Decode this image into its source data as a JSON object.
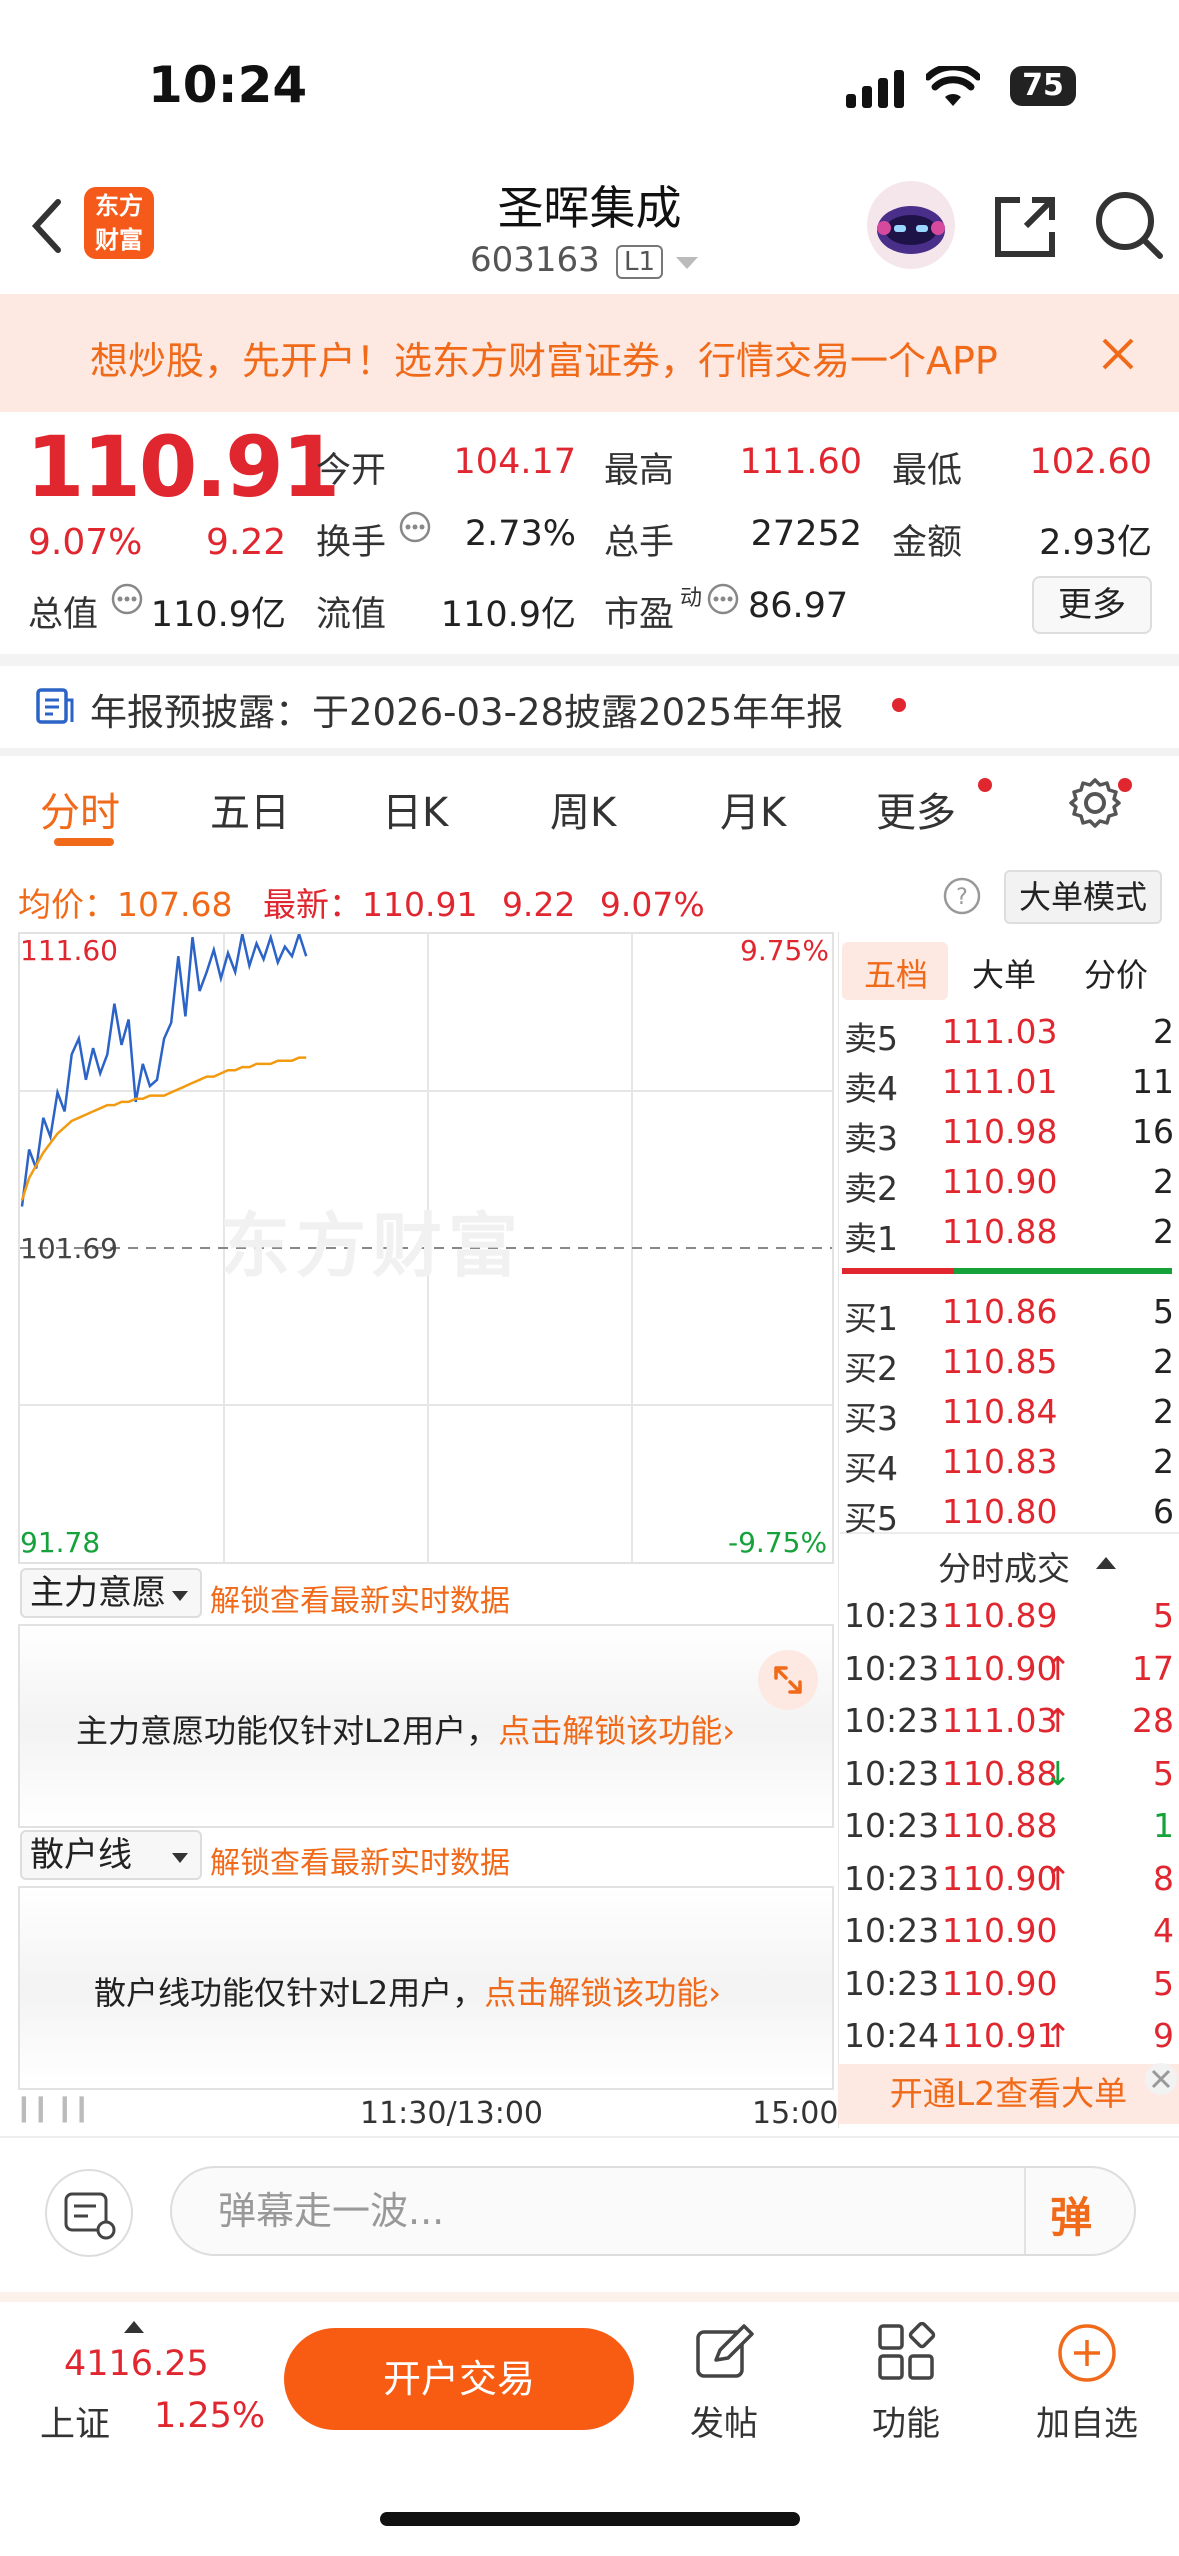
{
  "status": {
    "time": "10:24",
    "battery": "75"
  },
  "header": {
    "logo": [
      "东方",
      "财富"
    ],
    "title": "圣晖集成",
    "code": "603163",
    "level": "L1"
  },
  "banner": {
    "text": "想炒股，先开户！选东方财富证券，行情交易一个APP"
  },
  "quote": {
    "price": "110.91",
    "pct": "9.07%",
    "change": "9.22",
    "open_label": "今开",
    "open": "104.17",
    "high_label": "最高",
    "high": "111.60",
    "low_label": "最低",
    "low": "102.60",
    "turnover_label": "换手",
    "turnover": "2.73%",
    "volume_label": "总手",
    "volume": "27252",
    "amount_label": "金额",
    "amount": "2.93亿",
    "mktcap_label": "总值",
    "mktcap": "110.9亿",
    "float_label": "流值",
    "float": "110.9亿",
    "pe_label": "市盈",
    "pe_sup": "动",
    "pe": "86.97",
    "more": "更多"
  },
  "notice": {
    "text": "年报预披露：于2026-03-28披露2025年年报"
  },
  "tabs": [
    "分时",
    "五日",
    "日K",
    "周K",
    "月K",
    "更多"
  ],
  "info": {
    "avg_label": "均价：",
    "avg": "107.68",
    "last_label": "最新：",
    "last": "110.91",
    "chg": "9.22",
    "pct": "9.07%",
    "big_order": "大单模式"
  },
  "chart_data": {
    "type": "line",
    "title": "",
    "ylim": [
      91.78,
      111.6
    ],
    "y_top_label": "111.60",
    "y_mid_label": "101.69",
    "y_bottom_label": "91.78",
    "pct_top_label": "9.75%",
    "pct_bottom_label": "-9.75%",
    "x_labels": [
      "",
      "11:30/13:00",
      "15:00"
    ],
    "series": [
      {
        "color": "#2b63c6",
        "values": [
          103.0,
          104.8,
          104.2,
          105.8,
          105.2,
          106.6,
          106.0,
          107.8,
          108.3,
          107.0,
          108.0,
          107.2,
          107.8,
          109.4,
          108.1,
          108.9,
          106.3,
          107.5,
          106.8,
          107.0,
          108.3,
          108.8,
          110.9,
          109.0,
          111.5,
          109.8,
          110.4,
          111.1,
          110.2,
          111.0,
          110.4,
          111.6,
          110.6,
          111.3,
          110.8,
          111.5,
          110.7,
          111.2,
          110.9,
          111.6,
          110.9
        ]
      },
      {
        "color": "#f29a10",
        "values": [
          103.2,
          103.9,
          104.3,
          104.7,
          105.0,
          105.3,
          105.5,
          105.7,
          105.8,
          105.9,
          106.0,
          106.1,
          106.2,
          106.2,
          106.3,
          106.3,
          106.4,
          106.4,
          106.5,
          106.5,
          106.5,
          106.6,
          106.7,
          106.8,
          106.9,
          107.0,
          107.1,
          107.1,
          107.2,
          107.3,
          107.3,
          107.4,
          107.4,
          107.5,
          107.5,
          107.5,
          107.6,
          107.6,
          107.6,
          107.7,
          107.7
        ]
      }
    ]
  },
  "watermark": "东方财富",
  "orderbook": {
    "tabs": [
      "五档",
      "大单",
      "分价"
    ],
    "sells": [
      {
        "label": "卖5",
        "price": "111.03",
        "vol": "2"
      },
      {
        "label": "卖4",
        "price": "111.01",
        "vol": "11"
      },
      {
        "label": "卖3",
        "price": "110.98",
        "vol": "16"
      },
      {
        "label": "卖2",
        "price": "110.90",
        "vol": "2"
      },
      {
        "label": "卖1",
        "price": "110.88",
        "vol": "2"
      }
    ],
    "buys": [
      {
        "label": "买1",
        "price": "110.86",
        "vol": "5"
      },
      {
        "label": "买2",
        "price": "110.85",
        "vol": "2"
      },
      {
        "label": "买3",
        "price": "110.84",
        "vol": "2"
      },
      {
        "label": "买4",
        "price": "110.83",
        "vol": "2"
      },
      {
        "label": "买5",
        "price": "110.80",
        "vol": "6"
      }
    ],
    "trades_title": "分时成交",
    "trades": [
      {
        "time": "10:23",
        "price": "110.89",
        "arrow": "",
        "vol": "5",
        "dir": "up"
      },
      {
        "time": "10:23",
        "price": "110.90",
        "arrow": "↑",
        "vol": "17",
        "dir": "up"
      },
      {
        "time": "10:23",
        "price": "111.03",
        "arrow": "↑",
        "vol": "28",
        "dir": "up"
      },
      {
        "time": "10:23",
        "price": "110.88",
        "arrow": "↓",
        "vol": "5",
        "dir": "up"
      },
      {
        "time": "10:23",
        "price": "110.88",
        "arrow": "",
        "vol": "1",
        "dir": "down"
      },
      {
        "time": "10:23",
        "price": "110.90",
        "arrow": "↑",
        "vol": "8",
        "dir": "up"
      },
      {
        "time": "10:23",
        "price": "110.90",
        "arrow": "",
        "vol": "4",
        "dir": "up"
      },
      {
        "time": "10:23",
        "price": "110.90",
        "arrow": "",
        "vol": "5",
        "dir": "up"
      },
      {
        "time": "10:24",
        "price": "110.91",
        "arrow": "↑",
        "vol": "9",
        "dir": "up"
      }
    ],
    "l2": "开通L2查看大单"
  },
  "panels": {
    "main": {
      "select": "主力意愿",
      "unlock": "解锁查看最新实时数据",
      "desc": "主力意愿功能仅针对L2用户，",
      "link": "点击解锁该功能"
    },
    "retail": {
      "select": "散户线",
      "unlock": "解锁查看最新实时数据",
      "desc": "散户线功能仅针对L2用户，",
      "link": "点击解锁该功能"
    }
  },
  "comment": {
    "placeholder": "弹幕走一波...",
    "danmu": "弹"
  },
  "bottom": {
    "index_value": "4116.25",
    "index_name": "上证",
    "index_pct": "1.25%",
    "trade": "开户交易",
    "post": "发帖",
    "func": "功能",
    "watch": "加自选"
  }
}
